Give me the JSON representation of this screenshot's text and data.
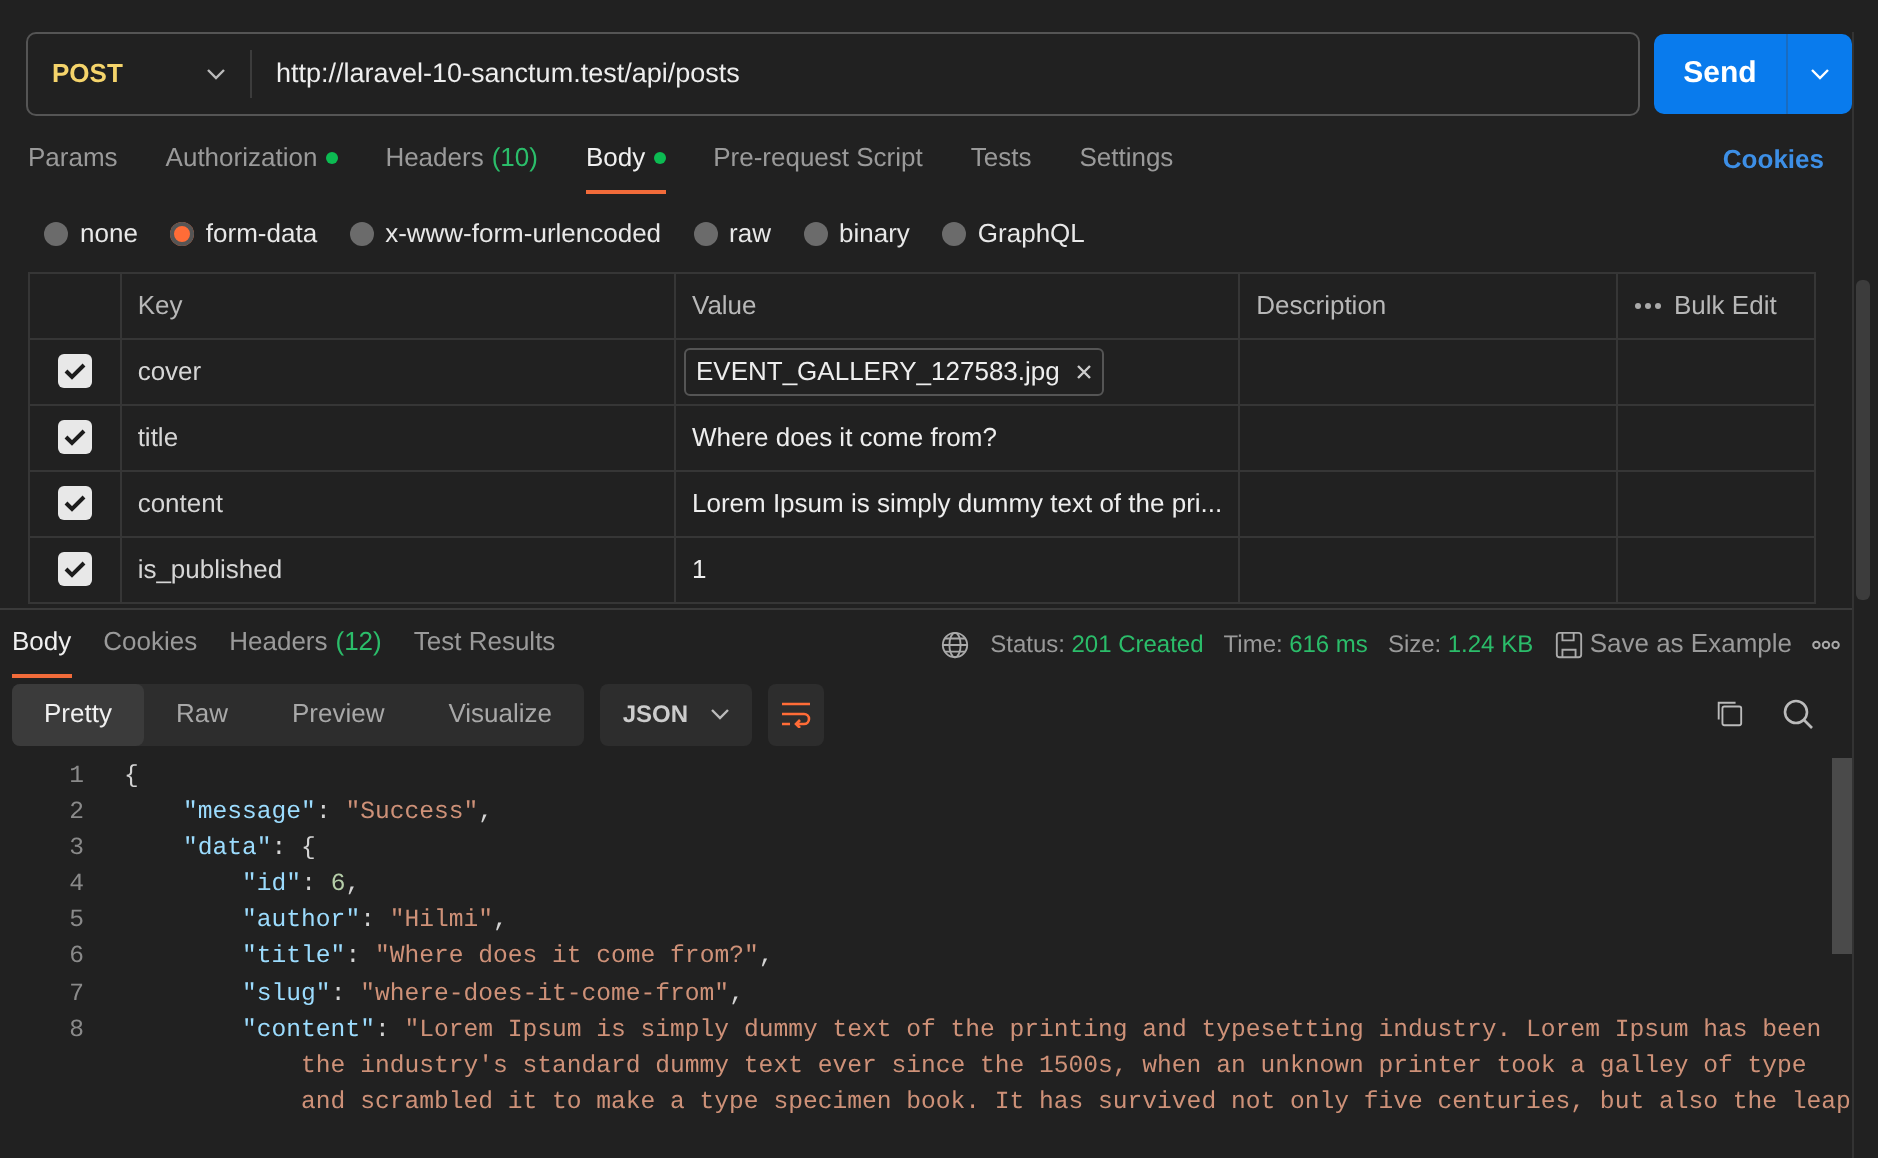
{
  "request": {
    "method": "POST",
    "url": "http://laravel-10-sanctum.test/api/posts",
    "send_label": "Send"
  },
  "request_tabs": [
    {
      "label": "Params",
      "selected": false
    },
    {
      "label": "Authorization",
      "selected": false,
      "dot": true
    },
    {
      "label": "Headers",
      "count": "(10)",
      "selected": false
    },
    {
      "label": "Body",
      "selected": true,
      "dot": true
    },
    {
      "label": "Pre-request Script",
      "selected": false
    },
    {
      "label": "Tests",
      "selected": false
    },
    {
      "label": "Settings",
      "selected": false
    }
  ],
  "cookies_link": "Cookies",
  "body_types": [
    {
      "label": "none",
      "selected": false
    },
    {
      "label": "form-data",
      "selected": true
    },
    {
      "label": "x-www-form-urlencoded",
      "selected": false
    },
    {
      "label": "raw",
      "selected": false
    },
    {
      "label": "binary",
      "selected": false
    },
    {
      "label": "GraphQL",
      "selected": false
    }
  ],
  "form_table": {
    "columns": [
      "Key",
      "Value",
      "Description"
    ],
    "bulk_edit": "Bulk Edit",
    "rows": [
      {
        "checked": true,
        "key": "cover",
        "kind": "file",
        "value": "EVENT_GALLERY_127583.jpg"
      },
      {
        "checked": true,
        "key": "title",
        "kind": "text",
        "value": "Where does it come from?"
      },
      {
        "checked": true,
        "key": "content",
        "kind": "text",
        "value": "Lorem Ipsum is simply dummy text of the pri..."
      },
      {
        "checked": true,
        "key": "is_published",
        "kind": "text",
        "value": "1"
      }
    ]
  },
  "response_tabs": [
    {
      "label": "Body",
      "selected": true
    },
    {
      "label": "Cookies",
      "selected": false
    },
    {
      "label": "Headers",
      "count": "(12)",
      "selected": false
    },
    {
      "label": "Test Results",
      "selected": false
    }
  ],
  "response_meta": {
    "status_label": "Status:",
    "status": "201 Created",
    "time_label": "Time:",
    "time": "616 ms",
    "size_label": "Size:",
    "size": "1.24 KB",
    "save_label": "Save as Example"
  },
  "view_modes": [
    {
      "label": "Pretty",
      "selected": true
    },
    {
      "label": "Raw",
      "selected": false
    },
    {
      "label": "Preview",
      "selected": false
    },
    {
      "label": "Visualize",
      "selected": false
    }
  ],
  "format": "JSON",
  "code_lines": [
    {
      "number": "1",
      "segments": [
        {
          "kind": "punct",
          "text": "{"
        }
      ]
    },
    {
      "number": "2",
      "segments": [
        {
          "kind": "key",
          "text": "    \"message\""
        },
        {
          "kind": "punct",
          "text": ": "
        },
        {
          "kind": "string",
          "text": "\"Success\""
        },
        {
          "kind": "punct",
          "text": ","
        }
      ]
    },
    {
      "number": "3",
      "segments": [
        {
          "kind": "key",
          "text": "    \"data\""
        },
        {
          "kind": "punct",
          "text": ": {"
        }
      ]
    },
    {
      "number": "4",
      "segments": [
        {
          "kind": "key",
          "text": "        \"id\""
        },
        {
          "kind": "punct",
          "text": ": "
        },
        {
          "kind": "number",
          "text": "6"
        },
        {
          "kind": "punct",
          "text": ","
        }
      ]
    },
    {
      "number": "5",
      "segments": [
        {
          "kind": "key",
          "text": "        \"author\""
        },
        {
          "kind": "punct",
          "text": ": "
        },
        {
          "kind": "string",
          "text": "\"Hilmi\""
        },
        {
          "kind": "punct",
          "text": ","
        }
      ]
    },
    {
      "number": "6",
      "segments": [
        {
          "kind": "key",
          "text": "        \"title\""
        },
        {
          "kind": "punct",
          "text": ": "
        },
        {
          "kind": "string",
          "text": "\"Where does it come from?\""
        },
        {
          "kind": "punct",
          "text": ","
        }
      ]
    },
    {
      "number": "7",
      "segments": [
        {
          "kind": "key",
          "text": "        \"slug\""
        },
        {
          "kind": "punct",
          "text": ": "
        },
        {
          "kind": "string",
          "text": "\"where-does-it-come-from\""
        },
        {
          "kind": "punct",
          "text": ","
        }
      ]
    },
    {
      "number": "8",
      "segments": [
        {
          "kind": "key",
          "text": "        \"content\""
        },
        {
          "kind": "punct",
          "text": ": "
        },
        {
          "kind": "string",
          "text": "\"Lorem Ipsum is simply dummy text of the printing and typesetting industry. Lorem Ipsum has been"
        }
      ]
    },
    {
      "segments": [
        {
          "kind": "string",
          "text": "            the industry's standard dummy text ever since the 1500s, when an unknown printer took a galley of type"
        }
      ]
    },
    {
      "segments": [
        {
          "kind": "string",
          "text": "            and scrambled it to make a type specimen book. It has survived not only five centuries, but also the leap"
        }
      ]
    }
  ]
}
